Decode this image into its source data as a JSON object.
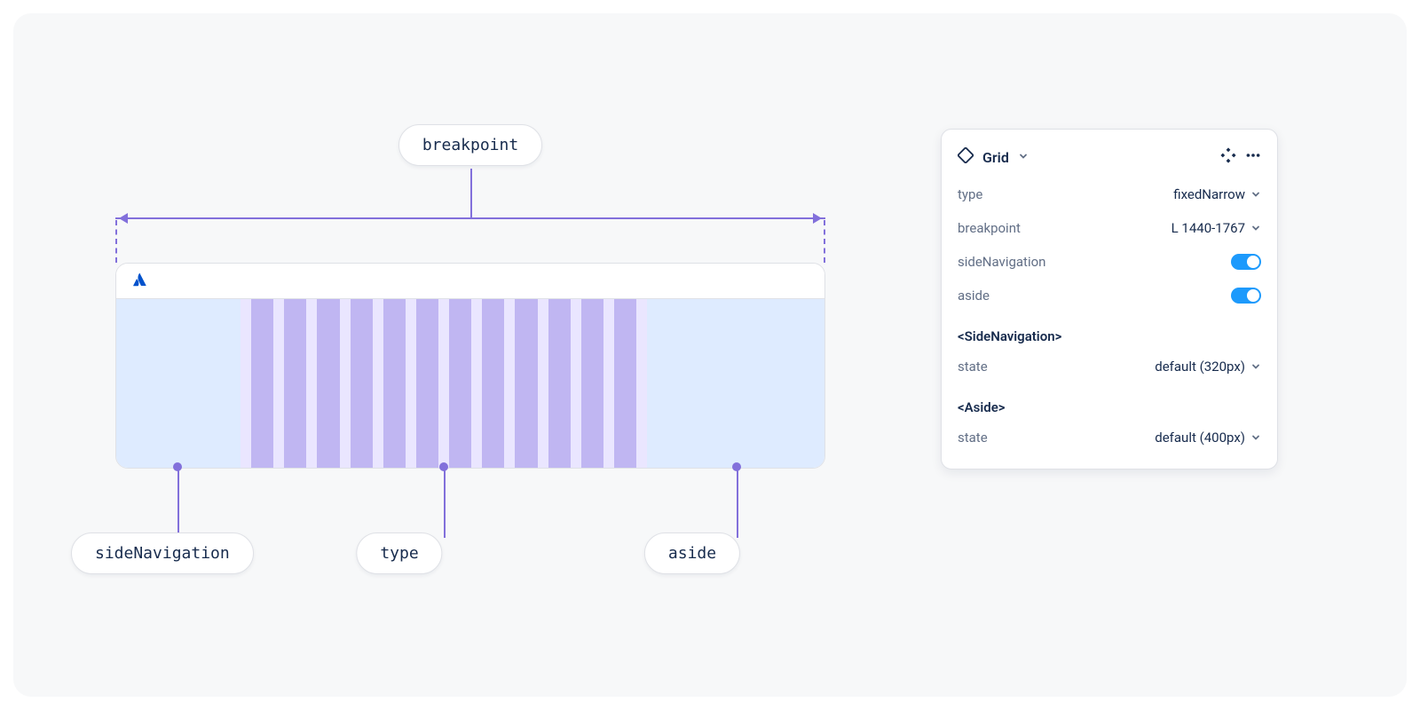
{
  "diagram": {
    "top_label": "breakpoint",
    "bottom_labels": {
      "side": "sideNavigation",
      "type": "type",
      "aside": "aside"
    },
    "grid_columns": 12
  },
  "panel": {
    "header_title": "Grid",
    "rows": {
      "type_label": "type",
      "type_value": "fixedNarrow",
      "breakpoint_label": "breakpoint",
      "breakpoint_value": "L 1440-1767",
      "sideNavigation_label": "sideNavigation",
      "sideNavigation_value": "on",
      "aside_label": "aside",
      "aside_value": "on"
    },
    "sections": {
      "sideNav_heading": "<SideNavigation>",
      "sideNav_state_label": "state",
      "sideNav_state_value": "default (320px)",
      "aside_heading": "<Aside>",
      "aside_state_label": "state",
      "aside_state_value": "default (400px)"
    }
  },
  "colors": {
    "accent_purple": "#8270DB",
    "panel_blue": "#1D9AFC"
  }
}
